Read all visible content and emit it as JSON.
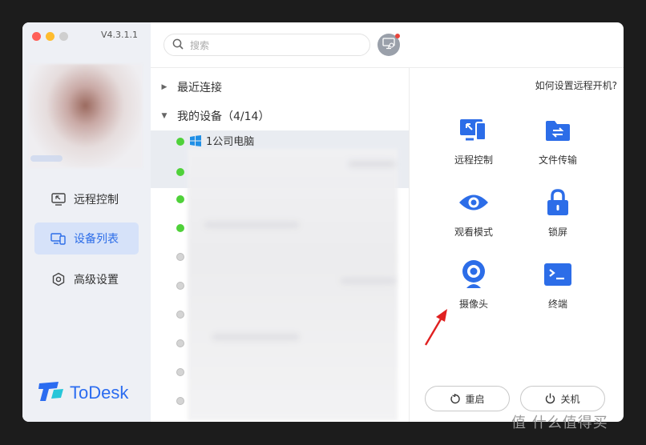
{
  "app": {
    "version": "V4.3.1.1",
    "logo_text": "ToDesk"
  },
  "sidebar": {
    "items": [
      {
        "label": "远程控制",
        "icon": "remote-monitor-icon",
        "active": false
      },
      {
        "label": "设备列表",
        "icon": "device-list-icon",
        "active": true
      },
      {
        "label": "高级设置",
        "icon": "settings-hex-icon",
        "active": false
      }
    ]
  },
  "search": {
    "placeholder": "搜索"
  },
  "device_list": {
    "groups": [
      {
        "label": "最近连接",
        "expanded": false
      },
      {
        "label": "我的设备（4/14）",
        "expanded": true
      }
    ],
    "devices": [
      {
        "name": "1公司电脑",
        "online": true,
        "os": "windows-icon"
      },
      {
        "name": "",
        "online": true
      },
      {
        "name": "",
        "online": true
      },
      {
        "name": "",
        "online": true
      },
      {
        "name": "",
        "online": false
      },
      {
        "name": "",
        "online": false
      },
      {
        "name": "",
        "online": false
      },
      {
        "name": "",
        "online": false
      },
      {
        "name": "",
        "online": false
      },
      {
        "name": "",
        "online": false
      }
    ]
  },
  "panel": {
    "help_link": "如何设置远程开机?",
    "actions": [
      {
        "label": "远程控制",
        "icon": "remote-control-icon"
      },
      {
        "label": "文件传输",
        "icon": "file-transfer-icon"
      },
      {
        "label": "观看模式",
        "icon": "eye-icon"
      },
      {
        "label": "锁屏",
        "icon": "lock-icon"
      },
      {
        "label": "摄像头",
        "icon": "camera-icon"
      },
      {
        "label": "终端",
        "icon": "terminal-icon"
      }
    ],
    "restart_label": "重启",
    "shutdown_label": "关机"
  },
  "colors": {
    "accent": "#2c6de8",
    "online": "#4fd13a",
    "offline": "#d4d4d4",
    "arrow": "#e02020"
  },
  "watermark": "值 什么值得买"
}
